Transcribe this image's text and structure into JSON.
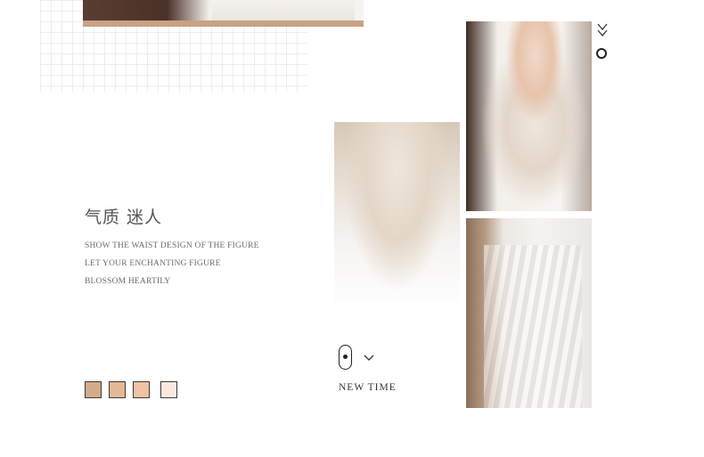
{
  "heading": {
    "title": "气质 迷人"
  },
  "tagline": {
    "line1": "SHOW THE WAIST DESIGN OF THE FIGURE",
    "line2": "LET YOUR ENCHANTING FIGURE",
    "line3": "BLOSSOM HEARTILY"
  },
  "swatches": [
    {
      "color": "#d4ab8a"
    },
    {
      "color": "#e3b896"
    },
    {
      "color": "#f2c3a2"
    },
    {
      "color": "#fbe9df"
    }
  ],
  "scroll_hint": {
    "label": "NEW TIME"
  },
  "icons": {
    "double_chevron": "double-chevron-down-icon",
    "ring": "ring-icon",
    "scroll_mouse": "scroll-mouse-icon",
    "chevron": "chevron-down-icon"
  }
}
